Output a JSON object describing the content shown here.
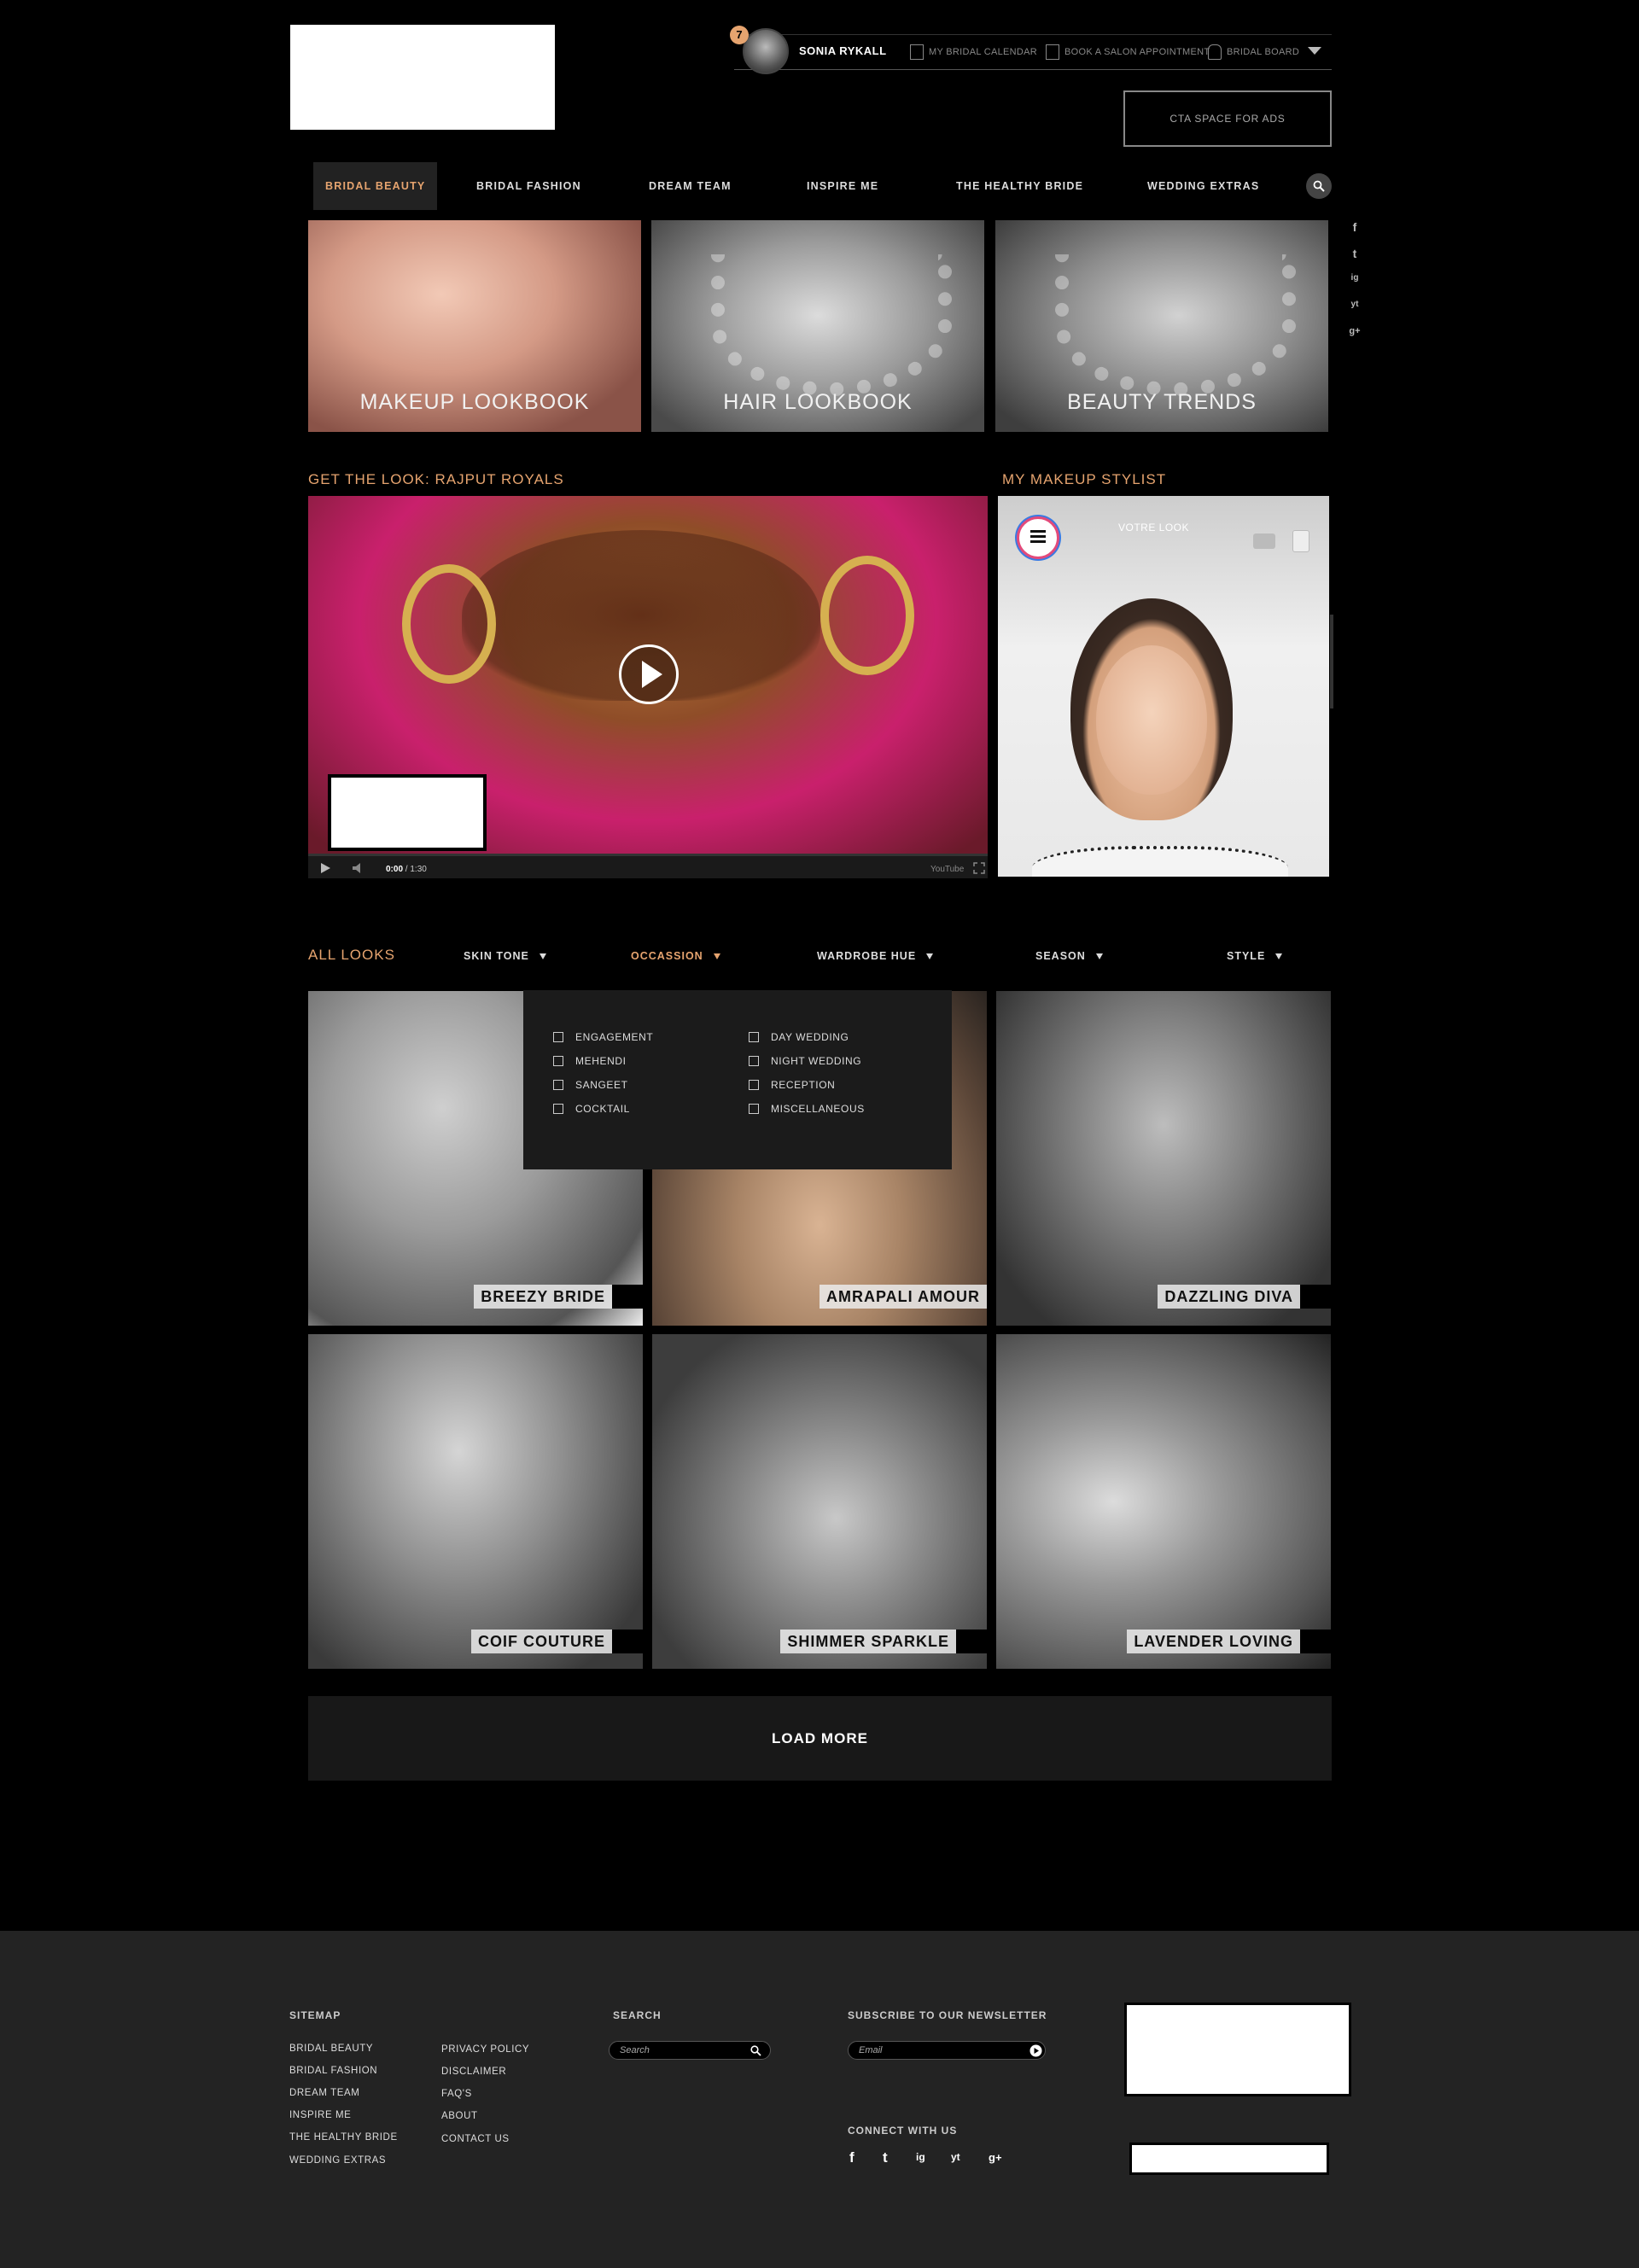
{
  "header": {
    "user": {
      "name": "SONIA RYKALL",
      "notifications": "7"
    },
    "top_links": [
      "MY BRIDAL CALENDAR",
      "BOOK A SALON APPOINTMENT",
      "BRIDAL BOARD"
    ],
    "cta": "CTA SPACE FOR ADS"
  },
  "nav": {
    "items": [
      "BRIDAL BEAUTY",
      "BRIDAL FASHION",
      "DREAM TEAM",
      "INSPIRE ME",
      "THE HEALTHY BRIDE",
      "WEDDING EXTRAS"
    ],
    "active": "BRIDAL BEAUTY"
  },
  "social": [
    "f",
    "t",
    "ig",
    "yt",
    "g+"
  ],
  "lookbooks": [
    "MAKEUP LOOKBOOK",
    "HAIR LOOKBOOK",
    "BEAUTY TRENDS"
  ],
  "video": {
    "title": "GET THE LOOK: RAJPUT ROYALS",
    "time_current": "0:00",
    "time_total": "/ 1:30",
    "brand": "YouTube"
  },
  "stylist": {
    "title": "MY MAKEUP STYLIST",
    "overlay": "VOTRE LOOK"
  },
  "filters": {
    "all_looks": "ALL LOOKS",
    "items": [
      "SKIN TONE",
      "OCCASSION",
      "WARDROBE HUE",
      "SEASON",
      "STYLE"
    ],
    "active": "OCCASSION",
    "occasion_options": [
      "ENGAGEMENT",
      "MEHENDI",
      "SANGEET",
      "COCKTAIL",
      "DAY WEDDING",
      "NIGHT WEDDING",
      "RECEPTION",
      "MISCELLANEOUS"
    ]
  },
  "looks": [
    "BREEZY BRIDE",
    "AMRAPALI AMOUR",
    "DAZZLING DIVA",
    "COIF COUTURE",
    "SHIMMER SPARKLE",
    "LAVENDER LOVING"
  ],
  "load_more": "LOAD MORE",
  "footer": {
    "sitemap_title": "SITEMAP",
    "sitemap_col1": [
      "BRIDAL BEAUTY",
      "BRIDAL FASHION",
      "DREAM TEAM",
      "INSPIRE ME",
      "THE HEALTHY BRIDE",
      "WEDDING EXTRAS"
    ],
    "sitemap_col2": [
      "PRIVACY POLICY",
      "DISCLAIMER",
      "FAQ'S",
      "ABOUT",
      "CONTACT US"
    ],
    "search_title": "SEARCH",
    "search_placeholder": "Search",
    "newsletter_title": "SUBSCRIBE TO OUR NEWSLETTER",
    "email_placeholder": "Email",
    "connect_title": "CONNECT WITH US"
  },
  "colors": {
    "accent": "#e6a46f",
    "background": "#000000",
    "footer": "#232323"
  }
}
